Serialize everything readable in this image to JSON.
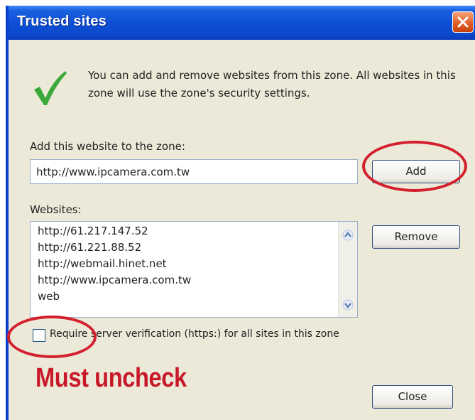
{
  "window": {
    "title": "Trusted sites",
    "close_icon": "close-icon"
  },
  "info_text": "You can add and remove websites from this zone. All websites in this zone will use the zone's security settings.",
  "add_section": {
    "label": "Add this website to the zone:",
    "input_value": "http://www.ipcamera.com.tw",
    "add_button": "Add"
  },
  "websites": {
    "label": "Websites:",
    "items": [
      "http://61.217.147.52",
      "http://61.221.88.52",
      "http://webmail.hinet.net",
      "http://www.ipcamera.com.tw",
      "web"
    ],
    "remove_button": "Remove"
  },
  "require_verification": {
    "label": "Require server verification (https:) for all sites in this zone",
    "checked": false
  },
  "annotation": "Must uncheck",
  "close_button": "Close",
  "colors": {
    "titlebar": "#0b48cc",
    "dialog_bg": "#ece9d8",
    "annotation_red": "#c8192a",
    "check_green": "#3aa83a"
  }
}
